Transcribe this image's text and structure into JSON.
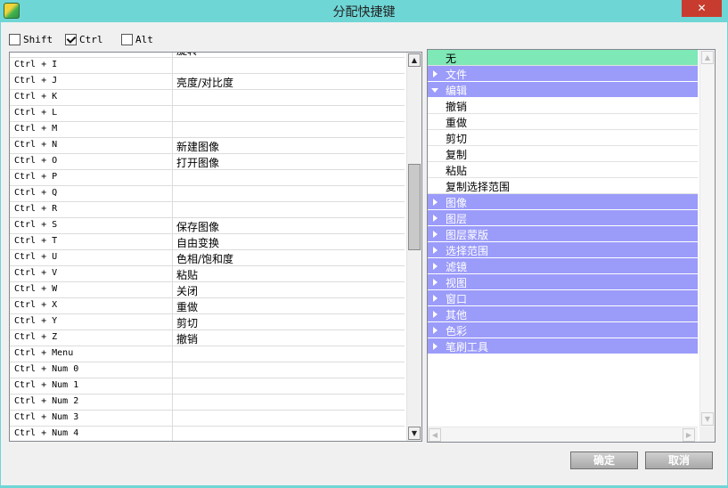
{
  "window": {
    "title": "分配快捷键",
    "close_label": "✕"
  },
  "modifiers": [
    {
      "label": "Shift",
      "checked": false
    },
    {
      "label": "Ctrl",
      "checked": true
    },
    {
      "label": "Alt",
      "checked": false
    }
  ],
  "shortcuts": [
    {
      "key": "",
      "func": "旋转"
    },
    {
      "key": "Ctrl + I",
      "func": ""
    },
    {
      "key": "Ctrl + J",
      "func": "亮度/对比度"
    },
    {
      "key": "Ctrl + K",
      "func": ""
    },
    {
      "key": "Ctrl + L",
      "func": ""
    },
    {
      "key": "Ctrl + M",
      "func": ""
    },
    {
      "key": "Ctrl + N",
      "func": "新建图像"
    },
    {
      "key": "Ctrl + O",
      "func": "打开图像"
    },
    {
      "key": "Ctrl + P",
      "func": ""
    },
    {
      "key": "Ctrl + Q",
      "func": ""
    },
    {
      "key": "Ctrl + R",
      "func": ""
    },
    {
      "key": "Ctrl + S",
      "func": "保存图像"
    },
    {
      "key": "Ctrl + T",
      "func": "自由变换"
    },
    {
      "key": "Ctrl + U",
      "func": "色相/饱和度"
    },
    {
      "key": "Ctrl + V",
      "func": "粘贴"
    },
    {
      "key": "Ctrl + W",
      "func": "关闭"
    },
    {
      "key": "Ctrl + X",
      "func": "重做"
    },
    {
      "key": "Ctrl + Y",
      "func": "剪切"
    },
    {
      "key": "Ctrl + Z",
      "func": "撤销"
    },
    {
      "key": "Ctrl + Menu",
      "func": ""
    },
    {
      "key": "Ctrl + Num 0",
      "func": ""
    },
    {
      "key": "Ctrl + Num 1",
      "func": ""
    },
    {
      "key": "Ctrl + Num 2",
      "func": ""
    },
    {
      "key": "Ctrl + Num 3",
      "func": ""
    },
    {
      "key": "Ctrl + Num 4",
      "func": ""
    }
  ],
  "categories": [
    {
      "type": "none",
      "label": "无",
      "selected": true
    },
    {
      "type": "category",
      "label": "文件",
      "expanded": false
    },
    {
      "type": "category",
      "label": "编辑",
      "expanded": true
    },
    {
      "type": "item",
      "label": "撤销"
    },
    {
      "type": "item",
      "label": "重做"
    },
    {
      "type": "item",
      "label": "剪切"
    },
    {
      "type": "item",
      "label": "复制"
    },
    {
      "type": "item",
      "label": "粘贴"
    },
    {
      "type": "item",
      "label": "复制选择范围"
    },
    {
      "type": "category",
      "label": "图像",
      "expanded": false
    },
    {
      "type": "category",
      "label": "图层",
      "expanded": false
    },
    {
      "type": "category",
      "label": "图层蒙版",
      "expanded": false
    },
    {
      "type": "category",
      "label": "选择范围",
      "expanded": false
    },
    {
      "type": "category",
      "label": "滤镜",
      "expanded": false
    },
    {
      "type": "category",
      "label": "视图",
      "expanded": false
    },
    {
      "type": "category",
      "label": "窗口",
      "expanded": false
    },
    {
      "type": "category",
      "label": "其他",
      "expanded": false
    },
    {
      "type": "category",
      "label": "色彩",
      "expanded": false
    },
    {
      "type": "category",
      "label": "笔刷工具",
      "expanded": false
    }
  ],
  "buttons": {
    "ok": "确定",
    "cancel": "取消"
  },
  "colors": {
    "titlebar": "#6fd6d6",
    "category": "#9b9bfa",
    "selected": "#7ee8b6",
    "close": "#c73c2e"
  },
  "icons": {
    "app": "app-icon",
    "close": "close-icon",
    "expand": "triangle-right-icon",
    "collapse": "triangle-down-icon"
  }
}
